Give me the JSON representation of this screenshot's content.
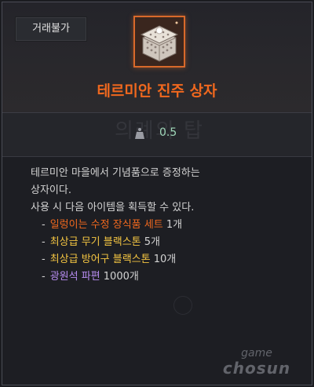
{
  "tooltip": {
    "tag_label": "거래불가",
    "item_name": "테르미안 진주 상자",
    "item_icon": "pearl-box-icon",
    "stats_ghost_text": "의례의 탑",
    "weight_icon": "weight-icon",
    "weight_value": "0.5",
    "description_lines": [
      "테르미안 마을에서 기념품으로 증정하는",
      "상자이다.",
      "사용 시 다음 아이템을 획득할 수 있다."
    ],
    "rewards": [
      {
        "name": "일렁이는 수정 장식품 세트",
        "qty": "1개",
        "color": "#f0681e"
      },
      {
        "name": "최상급 무기 블랙스톤",
        "qty": "5개",
        "color": "#f4c542"
      },
      {
        "name": "최상급 방어구 블랙스톤",
        "qty": "10개",
        "color": "#f4c542"
      },
      {
        "name": "광원석 파편",
        "qty": "1000개",
        "color": "#b78cf0"
      }
    ]
  },
  "watermark": {
    "line1": "game",
    "line2": "chosun"
  },
  "colors": {
    "title": "#f0681e",
    "weight": "#9fd8b9",
    "icon_frame": "#d9692a"
  }
}
